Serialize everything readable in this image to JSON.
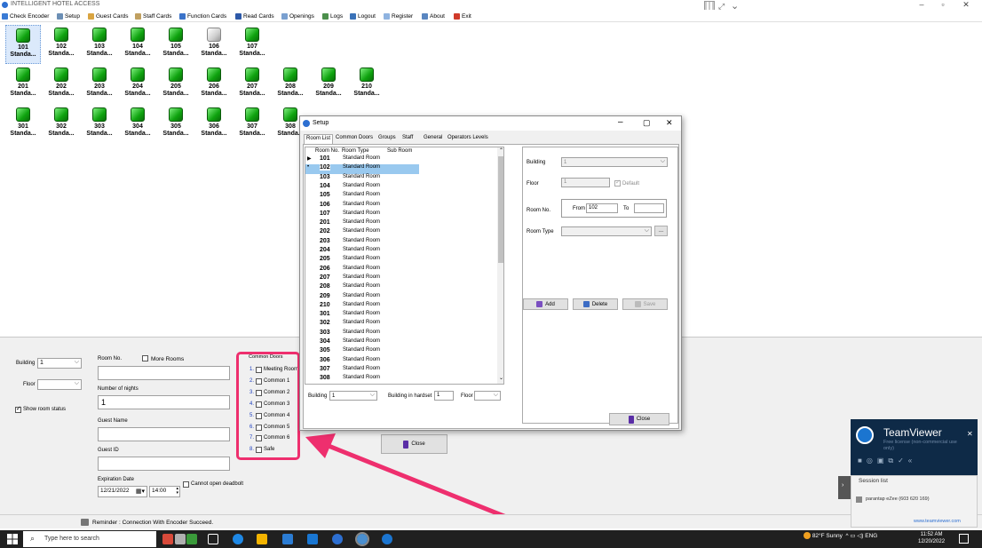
{
  "window": {
    "title": "INTELLIGENT HOTEL ACCESS"
  },
  "menu": [
    "Check Encoder",
    "Setup",
    "Guest Cards",
    "Staff Cards",
    "Function Cards",
    "Read Cards",
    "Openings",
    "Logs",
    "Logout",
    "Register",
    "About",
    "Exit"
  ],
  "rooms": [
    {
      "no": "101",
      "type": "Standa..."
    },
    {
      "no": "102",
      "type": "Standa..."
    },
    {
      "no": "103",
      "type": "Standa..."
    },
    {
      "no": "104",
      "type": "Standa..."
    },
    {
      "no": "105",
      "type": "Standa..."
    },
    {
      "no": "106",
      "type": "Standa..."
    },
    {
      "no": "107",
      "type": "Standa..."
    },
    {
      "no": "201",
      "type": "Standa..."
    },
    {
      "no": "202",
      "type": "Standa..."
    },
    {
      "no": "203",
      "type": "Standa..."
    },
    {
      "no": "204",
      "type": "Standa..."
    },
    {
      "no": "205",
      "type": "Standa..."
    },
    {
      "no": "206",
      "type": "Standa..."
    },
    {
      "no": "207",
      "type": "Standa..."
    },
    {
      "no": "208",
      "type": "Standa..."
    },
    {
      "no": "209",
      "type": "Standa..."
    },
    {
      "no": "210",
      "type": "Standa..."
    },
    {
      "no": "301",
      "type": "Standa..."
    },
    {
      "no": "302",
      "type": "Standa..."
    },
    {
      "no": "303",
      "type": "Standa..."
    },
    {
      "no": "304",
      "type": "Standa..."
    },
    {
      "no": "305",
      "type": "Standa..."
    },
    {
      "no": "306",
      "type": "Standa..."
    },
    {
      "no": "307",
      "type": "Standa..."
    },
    {
      "no": "308",
      "type": "Standa..."
    }
  ],
  "form": {
    "building_label": "Building",
    "building_value": "1",
    "floor_label": "Floor",
    "show_room_status": "Show room status",
    "room_no_label": "Room No.",
    "more_rooms": "More Rooms",
    "nights_label": "Number of nights",
    "nights_value": "1",
    "guest_name_label": "Guest Name",
    "guest_id_label": "Guest ID",
    "expiration_label": "Expiration Date",
    "expiration_date": "12/21/2022",
    "expiration_time": "14:00",
    "cannot_open_deadbolt": "Cannot open deadbolt",
    "common_doors_title": "Common Doors",
    "common_doors": [
      {
        "n": "1.",
        "label": "Meeting Room"
      },
      {
        "n": "2.",
        "label": "Common 1"
      },
      {
        "n": "3.",
        "label": "Common 2"
      },
      {
        "n": "4.",
        "label": "Common 3"
      },
      {
        "n": "5.",
        "label": "Common 4"
      },
      {
        "n": "6.",
        "label": "Common 5"
      },
      {
        "n": "7.",
        "label": "Common 6"
      },
      {
        "n": "8.",
        "label": "Safe"
      }
    ],
    "close": "Close"
  },
  "status": {
    "reminder": "Reminder : Connection With Encoder Succeed."
  },
  "setup": {
    "title": "Setup",
    "tabs": [
      "Room List",
      "Common Doors",
      "Groups",
      "Staff",
      "General",
      "Operators Levels"
    ],
    "columns": [
      "Room No.",
      "Room Type",
      "Sub Room"
    ],
    "rows": [
      {
        "no": "101",
        "type": "Standard Room"
      },
      {
        "no": "102",
        "type": "Standard Room"
      },
      {
        "no": "103",
        "type": "Standard Room"
      },
      {
        "no": "104",
        "type": "Standard Room"
      },
      {
        "no": "105",
        "type": "Standard Room"
      },
      {
        "no": "106",
        "type": "Standard Room"
      },
      {
        "no": "107",
        "type": "Standard Room"
      },
      {
        "no": "201",
        "type": "Standard Room"
      },
      {
        "no": "202",
        "type": "Standard Room"
      },
      {
        "no": "203",
        "type": "Standard Room"
      },
      {
        "no": "204",
        "type": "Standard Room"
      },
      {
        "no": "205",
        "type": "Standard Room"
      },
      {
        "no": "206",
        "type": "Standard Room"
      },
      {
        "no": "207",
        "type": "Standard Room"
      },
      {
        "no": "208",
        "type": "Standard Room"
      },
      {
        "no": "209",
        "type": "Standard Room"
      },
      {
        "no": "210",
        "type": "Standard Room"
      },
      {
        "no": "301",
        "type": "Standard Room"
      },
      {
        "no": "302",
        "type": "Standard Room"
      },
      {
        "no": "303",
        "type": "Standard Room"
      },
      {
        "no": "304",
        "type": "Standard Room"
      },
      {
        "no": "305",
        "type": "Standard Room"
      },
      {
        "no": "306",
        "type": "Standard Room"
      },
      {
        "no": "307",
        "type": "Standard Room"
      },
      {
        "no": "308",
        "type": "Standard Room"
      }
    ],
    "building_label": "Building",
    "building_value": "1",
    "building_in_hardset_label": "Building in hardset",
    "building_in_hardset_value": "1",
    "floor_label": "Floor",
    "right": {
      "building_label": "Building",
      "building_value": "1",
      "floor_label": "Floor",
      "floor_value": "1",
      "default": "Default",
      "room_no_label": "Room No.",
      "from_label": "From",
      "from_value": "102",
      "to_label": "To",
      "room_type_label": "Room Type",
      "browse": "..."
    },
    "add": "Add",
    "delete": "Delete",
    "save": "Save",
    "close": "Close"
  },
  "teamviewer": {
    "brand": "TeamViewer",
    "sub": "Free license (non-commercial use only)",
    "session_list": "Session list",
    "session": "parantap eZee (603 620 169)",
    "link": "www.teamviewer.com"
  },
  "taskbar": {
    "search": "Type here to search",
    "weather": "82°F  Sunny",
    "lang": "ENG",
    "time": "11:52 AM",
    "date": "12/20/2022"
  },
  "colors": {
    "highlight": "#ee2f6e",
    "selection": "#99c9ef",
    "room_ok": "#1fbf1f"
  }
}
